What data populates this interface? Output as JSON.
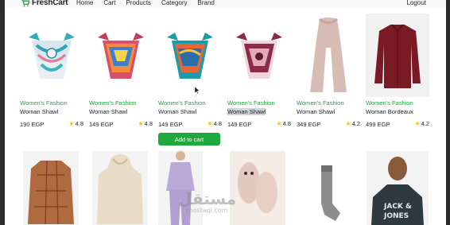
{
  "navbar": {
    "brand": "FreshCart",
    "links": [
      "Home",
      "Cart",
      "Products",
      "Category",
      "Brand"
    ],
    "logout": "Logout"
  },
  "products": [
    {
      "category": "Women's Fashion",
      "title": "Woman Shawl",
      "price": "190 EGP",
      "rating": "4.8"
    },
    {
      "category": "Women's Fashion",
      "title": "Woman Shawl",
      "price": "149 EGP",
      "rating": "4.8"
    },
    {
      "category": "Women's Fashion",
      "title": "Woman Shawl",
      "price": "149 EGP",
      "rating": "4.8"
    },
    {
      "category": "Women's Fashion",
      "title": "Woman Shawl",
      "price": "149 EGP",
      "rating": "4.8"
    },
    {
      "category": "Women's Fashion",
      "title": "Woman Shawl",
      "price": "349 EGP",
      "rating": "4.2"
    },
    {
      "category": "Women's Fashion",
      "title": "Woman Bordeaux",
      "price": "499 EGP",
      "rating": "4.2"
    }
  ],
  "add_to_cart": "Add to cart",
  "watermark": {
    "arabic": "مستقل",
    "latin": "mostaql.com"
  },
  "colors": {
    "accent_green": "#22a447",
    "button_green": "#1fa83b",
    "star": "#ffc107"
  }
}
